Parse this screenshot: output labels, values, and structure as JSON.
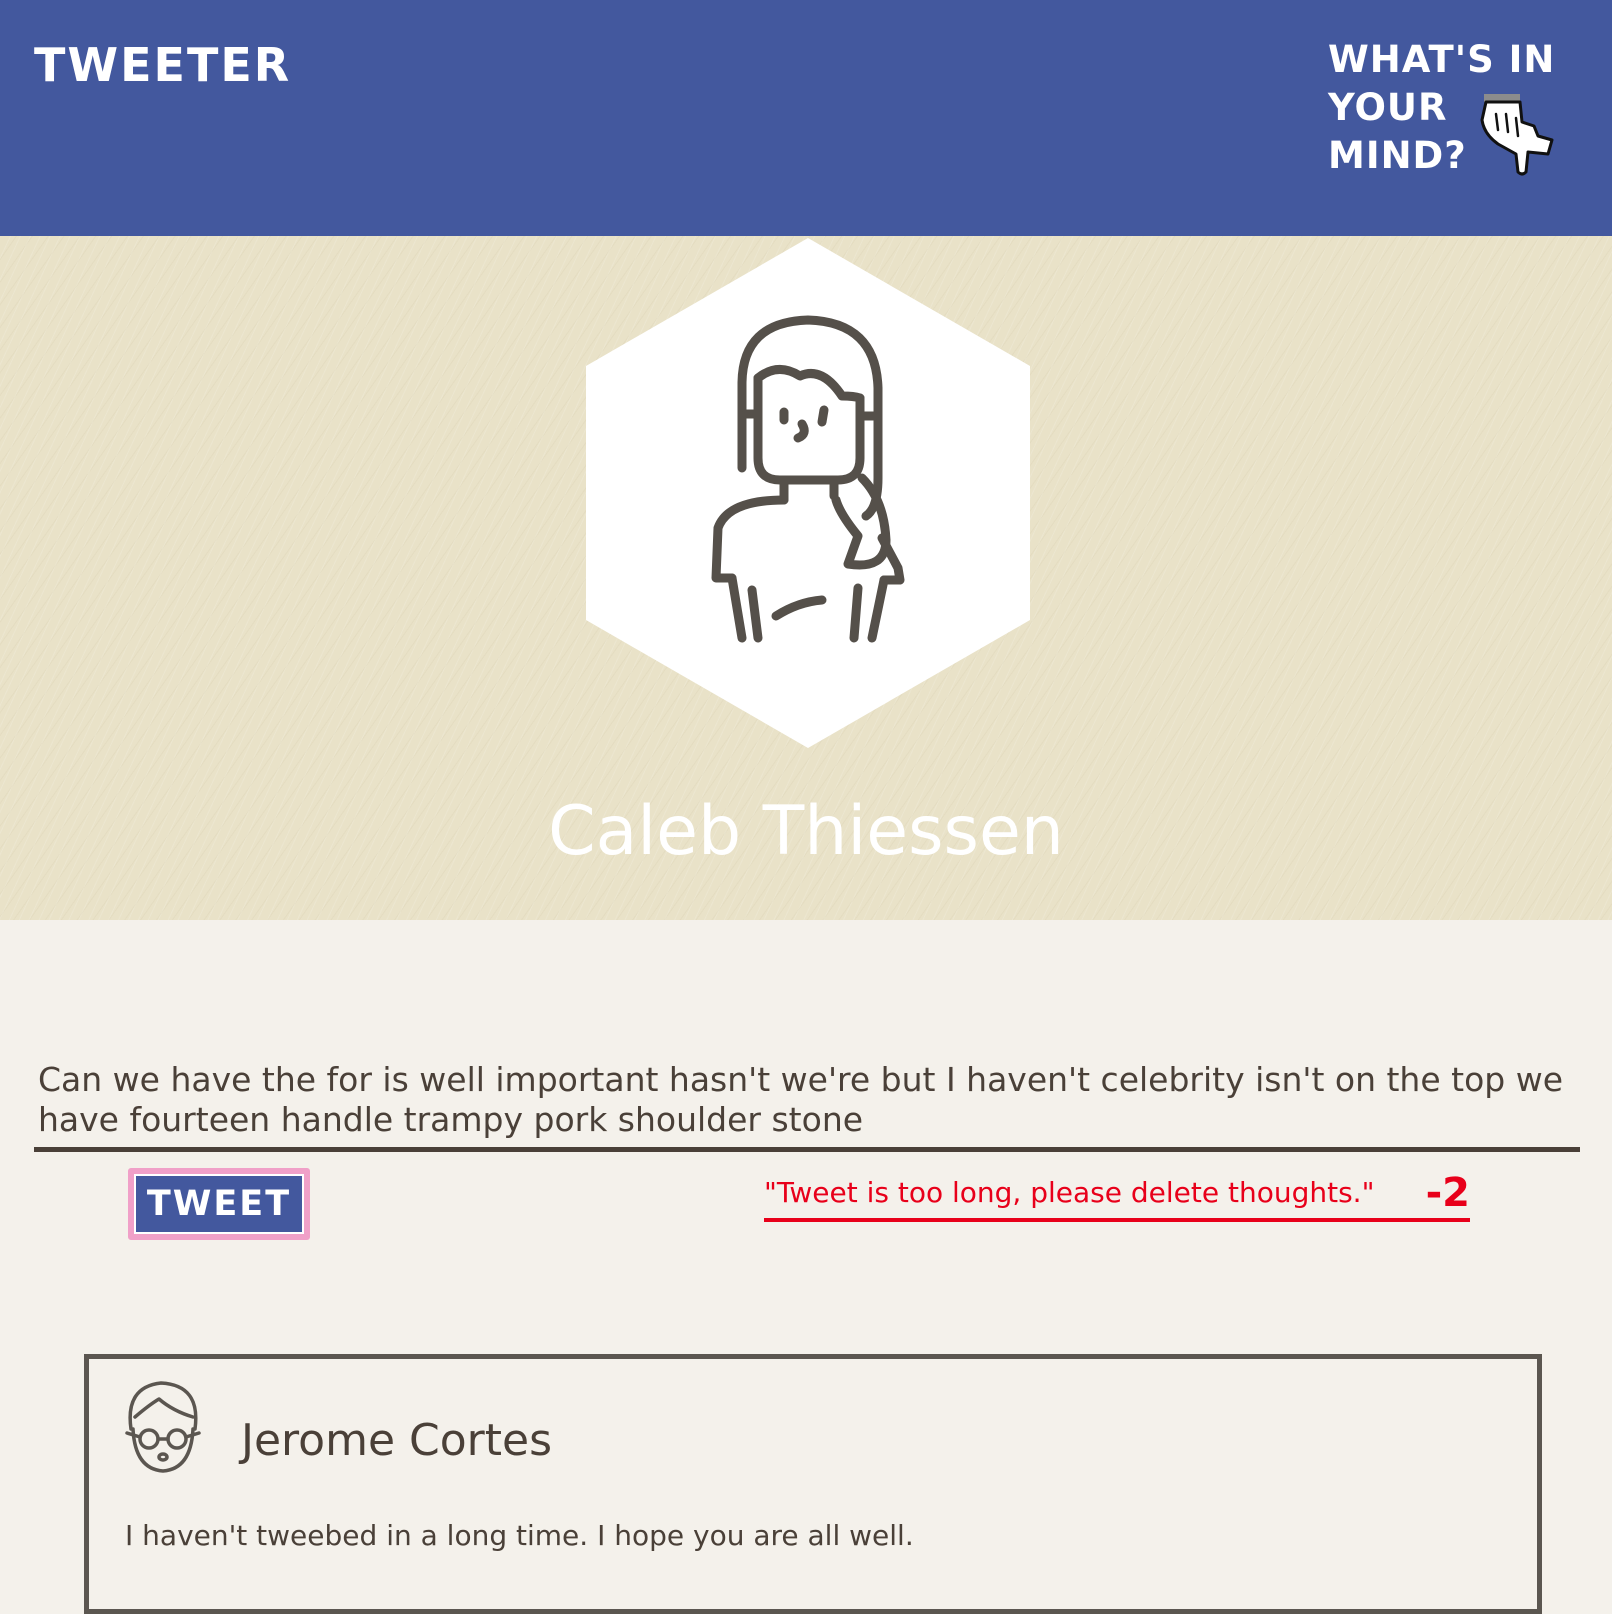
{
  "header": {
    "brand": "TWEETER",
    "prompt": "WHAT'S IN YOUR MIND?",
    "prompt_icon": "pointing-hand-icon",
    "background": "#43589e"
  },
  "profile": {
    "name": "Caleb Thiessen",
    "avatar_icon": "woman-avatar-icon",
    "hero_background": "#e9e2c8"
  },
  "composer": {
    "value": "Can we have the for is well important hasn't we're but I haven't celebrity isn't on the top we have fourteen handle trampy pork shoulder stone",
    "tweet_button_label": "TWEET",
    "error_message": "\"Tweet is too long, please delete thoughts.\"",
    "char_count": "-2",
    "error_color": "#e8001a"
  },
  "tweets": [
    {
      "author": "Jerome Cortes",
      "avatar_icon": "man-with-glasses-avatar-icon",
      "text": "I haven't tweebed in a long time. I hope you are all well."
    }
  ]
}
